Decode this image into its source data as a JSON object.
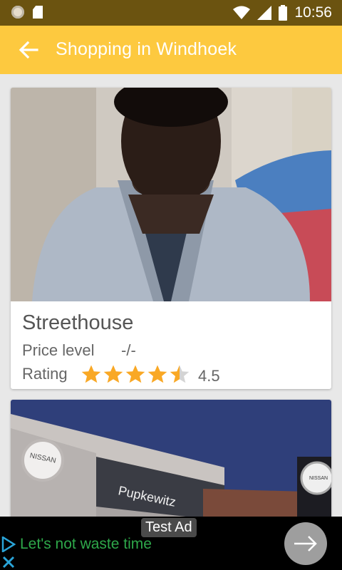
{
  "status_bar": {
    "time": "10:56",
    "icons": [
      "circle-icon",
      "sd-card-icon",
      "wifi-icon",
      "cell-signal-icon",
      "battery-icon"
    ]
  },
  "app_bar": {
    "title": "Shopping in Windhoek",
    "back_icon": "arrow-left-icon",
    "color": "#fdc93f"
  },
  "listings": [
    {
      "name": "Streethouse",
      "price_label": "Price level",
      "price_value": "-/-",
      "rating_label": "Rating",
      "rating": 4.5,
      "rating_text": "4.5",
      "star_color": "#f9a825"
    },
    {
      "photo_signage": [
        "NISSAN",
        "Pupkewitz",
        "NISSAN"
      ]
    }
  ],
  "ad": {
    "badge": "Test Ad",
    "text": "Let's not waste time",
    "text_color": "#2ea84a",
    "icons": [
      "adchoices-play-icon",
      "close-icon",
      "arrow-right-icon"
    ]
  }
}
